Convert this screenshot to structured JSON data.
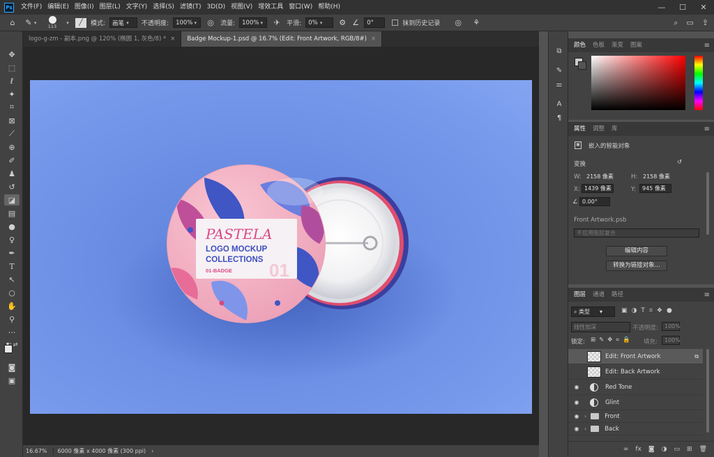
{
  "menubar": {
    "logo": "Ps",
    "items": [
      "文件(F)",
      "编辑(E)",
      "图像(I)",
      "图层(L)",
      "文字(Y)",
      "选择(S)",
      "滤镜(T)",
      "3D(D)",
      "视图(V)",
      "增效工具",
      "窗口(W)",
      "帮助(H)"
    ],
    "minimize": "—",
    "maximize": "☐",
    "close": "✕"
  },
  "options": {
    "brush_size": "113",
    "mode_label": "模式:",
    "mode_value": "画笔",
    "opacity_label": "不透明度:",
    "opacity_value": "100%",
    "flow_label": "流量:",
    "flow_value": "100%",
    "smooth_label": "平滑:",
    "smooth_value": "0%",
    "angle_value": "0°",
    "history_label": "抹到历史记录"
  },
  "tabs": [
    {
      "label": "logo-g-zm - 副本.png @ 120% (椭圆 1, 灰色/8) *",
      "close": "×"
    },
    {
      "label": "Badge Mockup-1.psd @ 16.7% (Edit: Front Artwork, RGB/8#)",
      "close": "×"
    }
  ],
  "badge": {
    "brand": "PASTELA",
    "line1": "LOGO MOCKUP",
    "line2": "COLLECTIONS",
    "code": "01-BADGE",
    "number": "01"
  },
  "status": {
    "zoom": "16.67%",
    "doc_info": "6000 像素 x 4000 像素 (300 ppi)",
    "arrow": "›"
  },
  "color_panel": {
    "tabs": [
      "颜色",
      "色板",
      "渐变",
      "图案"
    ],
    "menu": "≡"
  },
  "properties_panel": {
    "tabs": [
      "属性",
      "调整",
      "库"
    ],
    "menu": "≡",
    "type_label": "嵌入的智能对象",
    "transform_label": "变换",
    "w_label": "W:",
    "w_value": "2158 像素",
    "h_label": "H:",
    "h_value": "2158 像素",
    "x_label": "X:",
    "x_value": "1439 像素",
    "y_label": "Y:",
    "y_value": "945 像素",
    "angle_value": "0.00°",
    "file_name": "Front Artwork.psb",
    "comp_placeholder": "不应用图层复合",
    "edit_button": "编辑内容",
    "convert_button": "转换为链接对象..."
  },
  "layers_panel": {
    "tabs": [
      "图层",
      "通道",
      "路径"
    ],
    "menu": "≡",
    "filter_label": "类型",
    "blend_mode": "线性加深",
    "opacity_label": "不透明度:",
    "opacity_value": "100%",
    "lock_label": "锁定:",
    "fill_label": "填充:",
    "fill_value": "100%",
    "layers": [
      {
        "name": "Edit: Front Artwork",
        "kind": "smart"
      },
      {
        "name": "Edit: Back Artwork",
        "kind": "smart"
      },
      {
        "name": "Red Tone",
        "kind": "adjust"
      },
      {
        "name": "Glint",
        "kind": "adjust"
      },
      {
        "name": "Front",
        "kind": "group"
      },
      {
        "name": "Back",
        "kind": "group"
      }
    ],
    "footer_icons": [
      "link-icon",
      "fx-icon",
      "mask-icon",
      "adjustment-icon",
      "folder-icon",
      "new-layer-icon",
      "trash-icon"
    ]
  },
  "colors": {
    "artboard_blue": "#6b8ee4",
    "badge_pink": "#f2a3b8",
    "accent_purple": "#3d4fbf",
    "ps_blue": "#31a8ff"
  }
}
